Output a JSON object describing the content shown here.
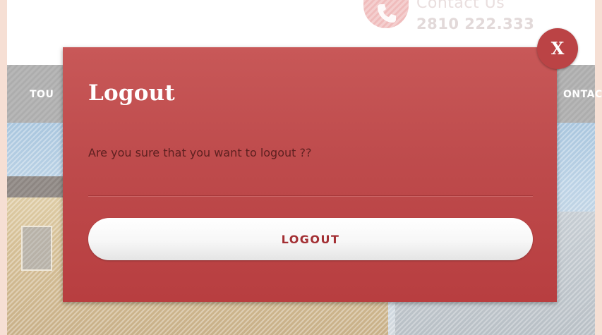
{
  "background_page": {
    "contact_title": "Contact Us",
    "contact_phone": "2810 222.333",
    "nav_left_fragment": "TOU",
    "nav_right_fragment": "ONTAC",
    "phone_icon": "phone-icon"
  },
  "modal": {
    "title": "Logout",
    "message": "Are you sure that you want to logout ??",
    "logout_button_label": "LOGOUT",
    "close_button_label": "X",
    "colors": {
      "modal_background": "#be4b4c",
      "button_text": "#a32f33",
      "message_text": "#5e2020"
    }
  }
}
